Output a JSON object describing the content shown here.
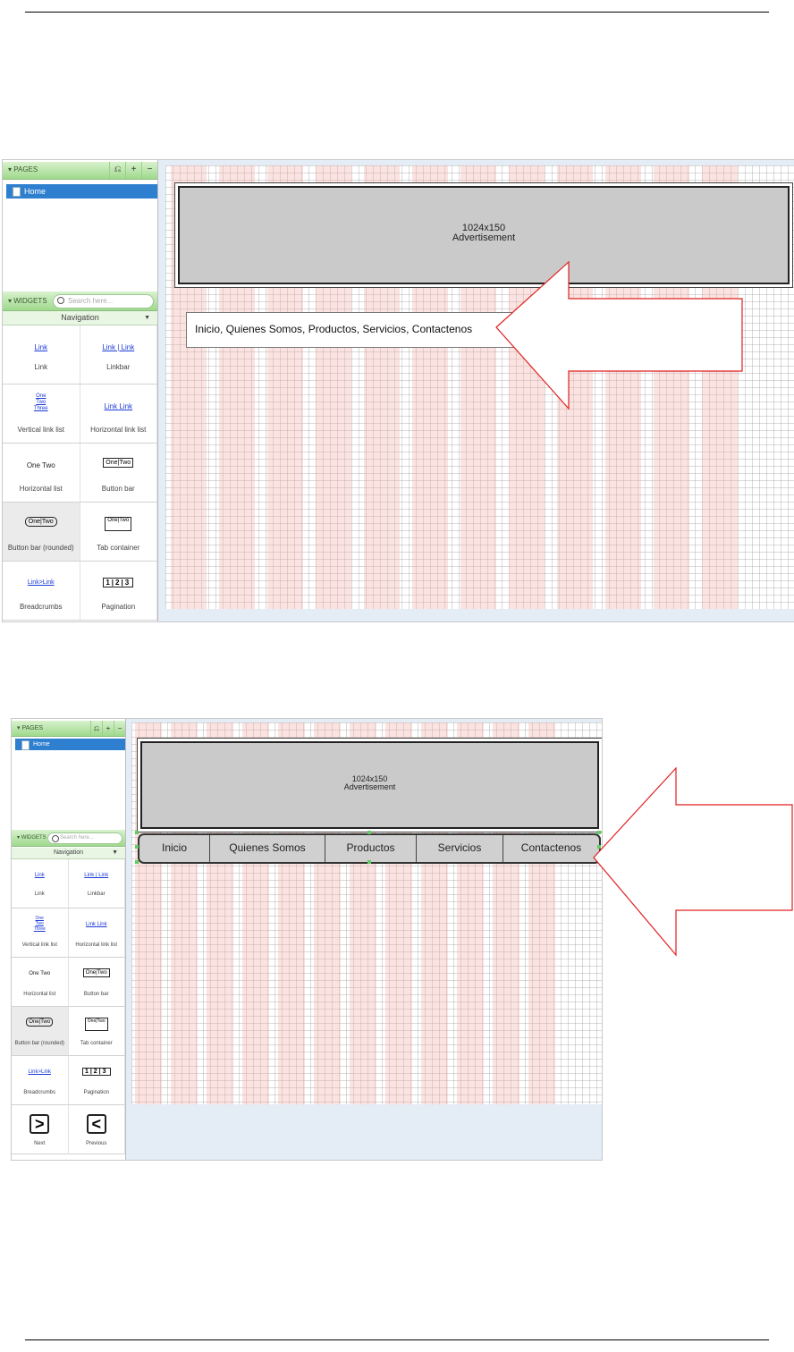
{
  "screen1": {
    "pages_label": "PAGES",
    "page_controls": [
      "⎌",
      "+",
      "−"
    ],
    "home_page": "Home",
    "widgets_label": "WIDGETS",
    "search_placeholder": "Search here...",
    "category": "Navigation",
    "widgets": [
      {
        "icon": "Link",
        "label": "Link"
      },
      {
        "icon": "Link | Link",
        "label": "Linkbar"
      },
      {
        "icon": "One Two Three",
        "label": "Vertical link list"
      },
      {
        "icon": "Link  Link",
        "label": "Horizontal link list"
      },
      {
        "icon": "One  Two",
        "label": "Horizontal list"
      },
      {
        "icon": "One|Two",
        "label": "Button bar"
      },
      {
        "icon": "One|Two",
        "label": "Button bar (rounded)"
      },
      {
        "icon": "One|Two",
        "label": "Tab container"
      },
      {
        "icon": "Link>Link",
        "label": "Breadcrumbs"
      },
      {
        "icon": "1|2|3",
        "label": "Pagination"
      }
    ],
    "ad_size": "1024x150",
    "ad_label": "Advertisement",
    "linkbar_text": "Inicio, Quienes Somos, Productos, Servicios, Contactenos"
  },
  "screen2": {
    "pages_label": "PAGES",
    "page_controls": [
      "⎌",
      "+",
      "−"
    ],
    "home_page": "Home",
    "widgets_label": "WIDGETS",
    "search_placeholder": "Search here...",
    "category": "Navigation",
    "widgets": [
      {
        "icon": "Link",
        "label": "Link"
      },
      {
        "icon": "Link | Link",
        "label": "Linkbar"
      },
      {
        "icon": "One Two Three",
        "label": "Vertical link list"
      },
      {
        "icon": "Link  Link",
        "label": "Horizontal link list"
      },
      {
        "icon": "One  Two",
        "label": "Horizontal list"
      },
      {
        "icon": "One|Two",
        "label": "Button bar"
      },
      {
        "icon": "One|Two",
        "label": "Button bar (rounded)"
      },
      {
        "icon": "One|Two",
        "label": "Tab container"
      },
      {
        "icon": "Link>Link",
        "label": "Breadcrumbs"
      },
      {
        "icon": "1|2|3",
        "label": "Pagination"
      },
      {
        "icon": ">",
        "label": "Next"
      },
      {
        "icon": "<",
        "label": "Previous"
      }
    ],
    "ad_size": "1024x150",
    "ad_label": "Advertisement",
    "nav_items": [
      "Inicio",
      "Quienes Somos",
      "Productos",
      "Servicios",
      "Contactenos"
    ]
  },
  "colors": {
    "arrow": "#e02020",
    "selection": "#5fcf5f",
    "page_highlight": "#2f7fd0"
  }
}
